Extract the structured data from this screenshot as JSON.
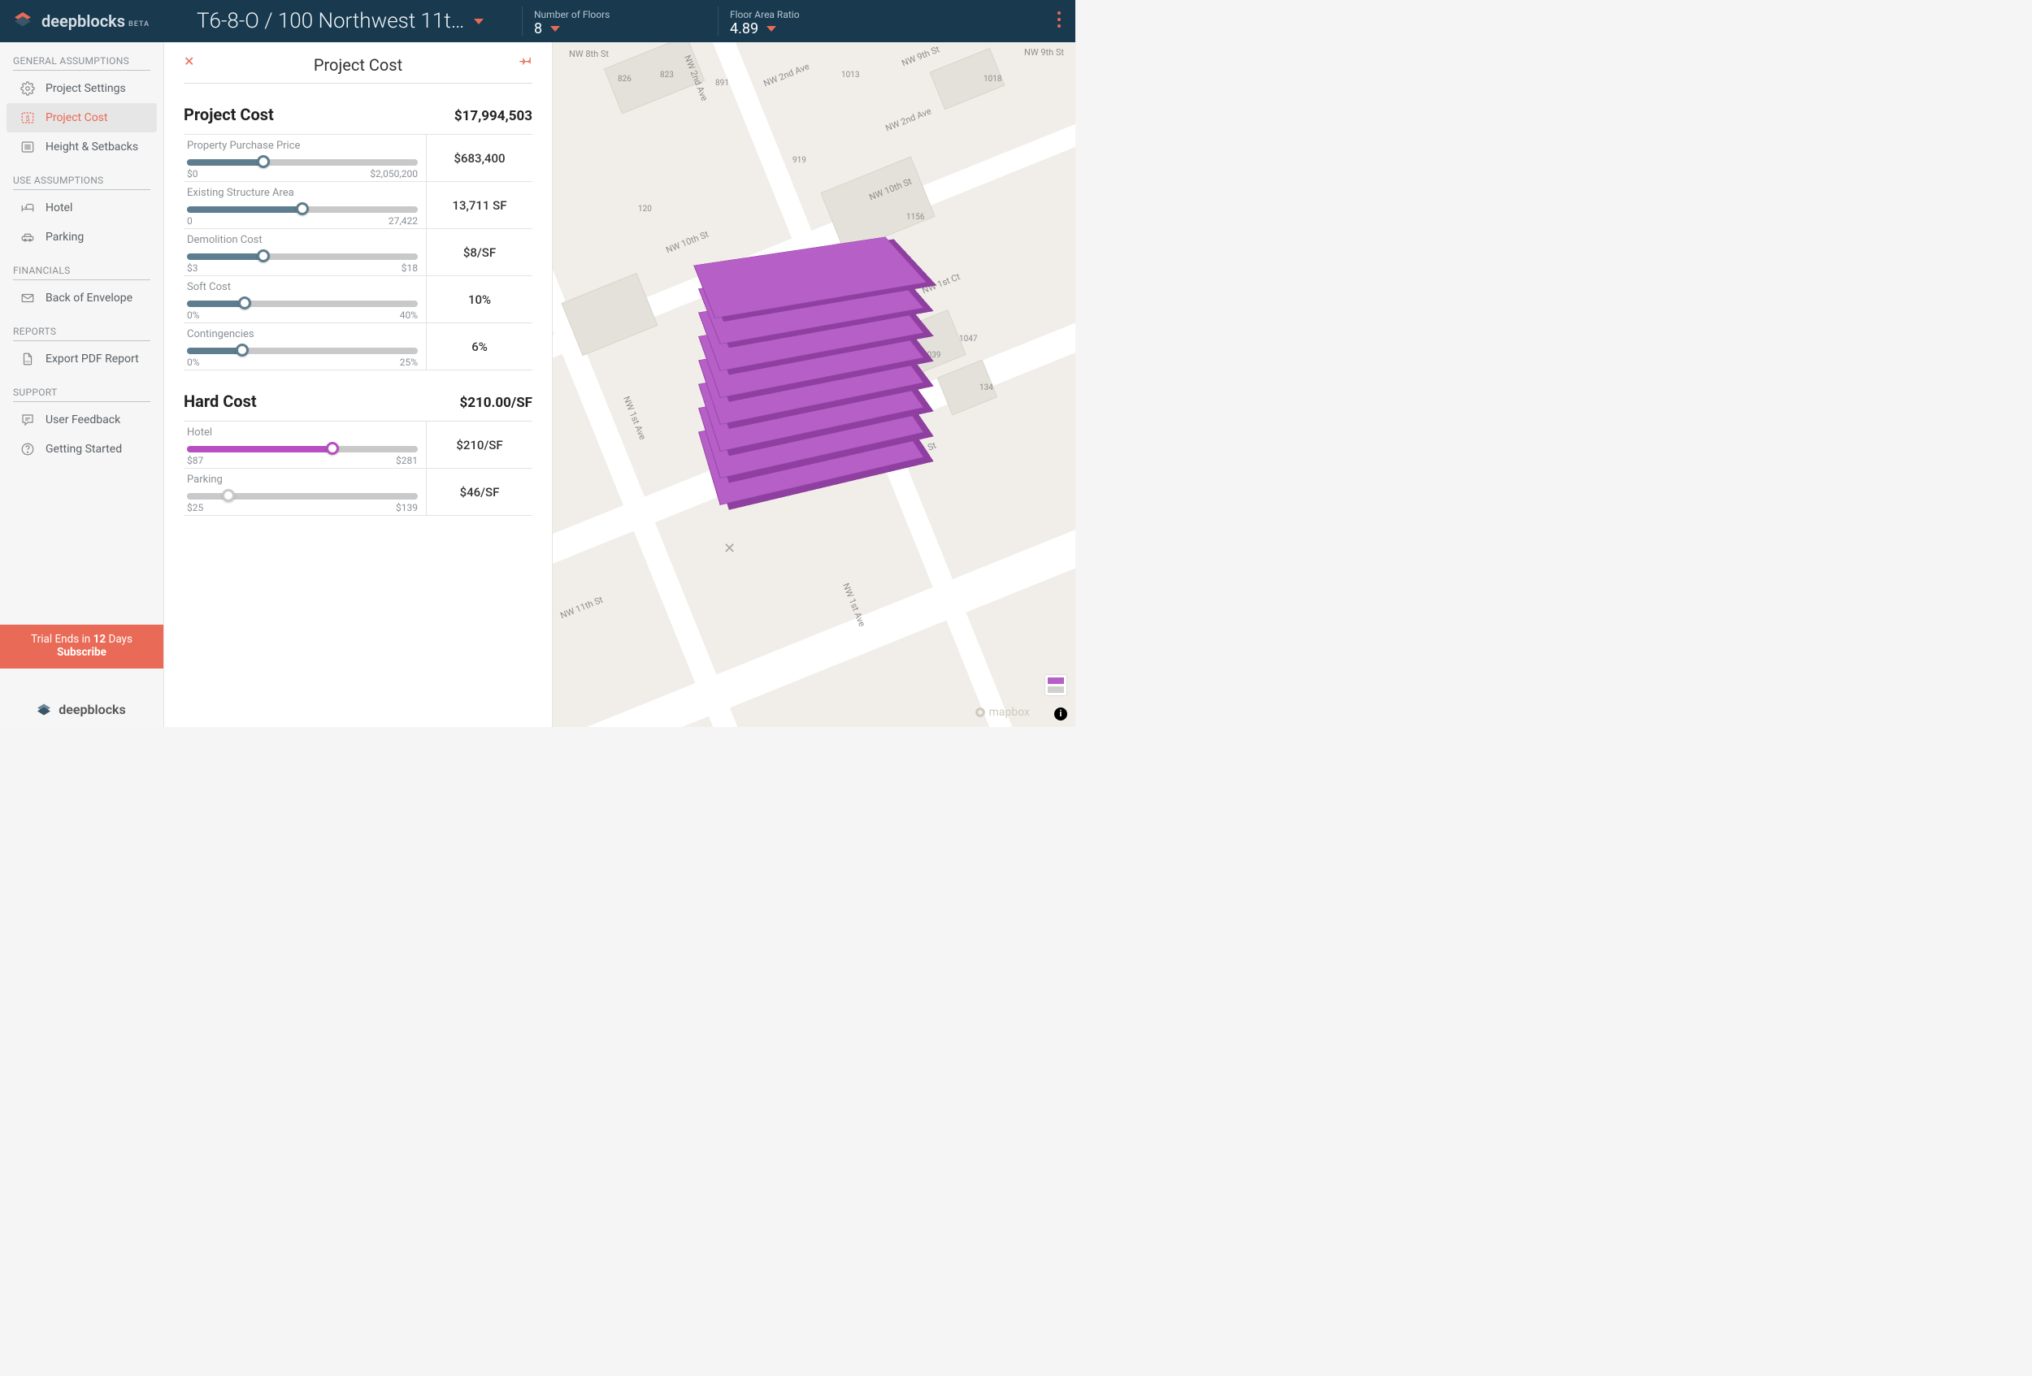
{
  "brand": {
    "name": "deepblocks",
    "beta": "BETA"
  },
  "header": {
    "project": "T6-8-O / 100 Northwest 11t…",
    "floors": {
      "label": "Number of Floors",
      "value": "8"
    },
    "far": {
      "label": "Floor Area Ratio",
      "value": "4.89"
    }
  },
  "sidebar": {
    "sections": {
      "general": "GENERAL ASSUMPTIONS",
      "use": "USE ASSUMPTIONS",
      "fin": "FINANCIALS",
      "rep": "REPORTS",
      "sup": "SUPPORT"
    },
    "items": {
      "settings": "Project Settings",
      "cost": "Project Cost",
      "height": "Height & Setbacks",
      "hotel": "Hotel",
      "parking": "Parking",
      "boe": "Back of Envelope",
      "pdf": "Export PDF Report",
      "feedback": "User Feedback",
      "gs": "Getting Started"
    },
    "trial": {
      "line1a": "Trial Ends in ",
      "line1b": "12",
      "line1c": " Days",
      "line2": "Subscribe"
    }
  },
  "panel": {
    "title": "Project Cost",
    "projectCost": {
      "heading": "Project Cost",
      "total": "$17,994,503",
      "rows": [
        {
          "label": "Property Purchase Price",
          "min": "$0",
          "max": "$2,050,200",
          "value": "$683,400",
          "pct": 33
        },
        {
          "label": "Existing Structure Area",
          "min": "0",
          "max": "27,422",
          "value": "13,711 SF",
          "pct": 50
        },
        {
          "label": "Demolition Cost",
          "min": "$3",
          "max": "$18",
          "value": "$8/SF",
          "pct": 33
        },
        {
          "label": "Soft Cost",
          "min": "0%",
          "max": "40%",
          "value": "10%",
          "pct": 25
        },
        {
          "label": "Contingencies",
          "min": "0%",
          "max": "25%",
          "value": "6%",
          "pct": 24
        }
      ]
    },
    "hardCost": {
      "heading": "Hard Cost",
      "total": "$210.00/SF",
      "rows": [
        {
          "label": "Hotel",
          "min": "$87",
          "max": "$281",
          "value": "$210/SF",
          "pct": 63,
          "color": "purple"
        },
        {
          "label": "Parking",
          "min": "$25",
          "max": "$139",
          "value": "$46/SF",
          "pct": 18,
          "color": "gray"
        }
      ]
    }
  },
  "map": {
    "streets": [
      "NW 8th St",
      "NW 2nd Ave",
      "NW 9th St",
      "NW 9th St",
      "NW 2nd Ave",
      "NW 2nd Ave",
      "NW 10th St",
      "NW 10th St",
      "NW 1st Ct",
      "NW 1st Ave",
      "NW 11th St",
      "NW 1st Ave",
      "NW 11th St"
    ],
    "lots": [
      "823",
      "826",
      "891",
      "1013",
      "1018",
      "919",
      "120",
      "1156",
      "1047",
      "1039",
      "134"
    ],
    "attribution": "mapbox"
  }
}
